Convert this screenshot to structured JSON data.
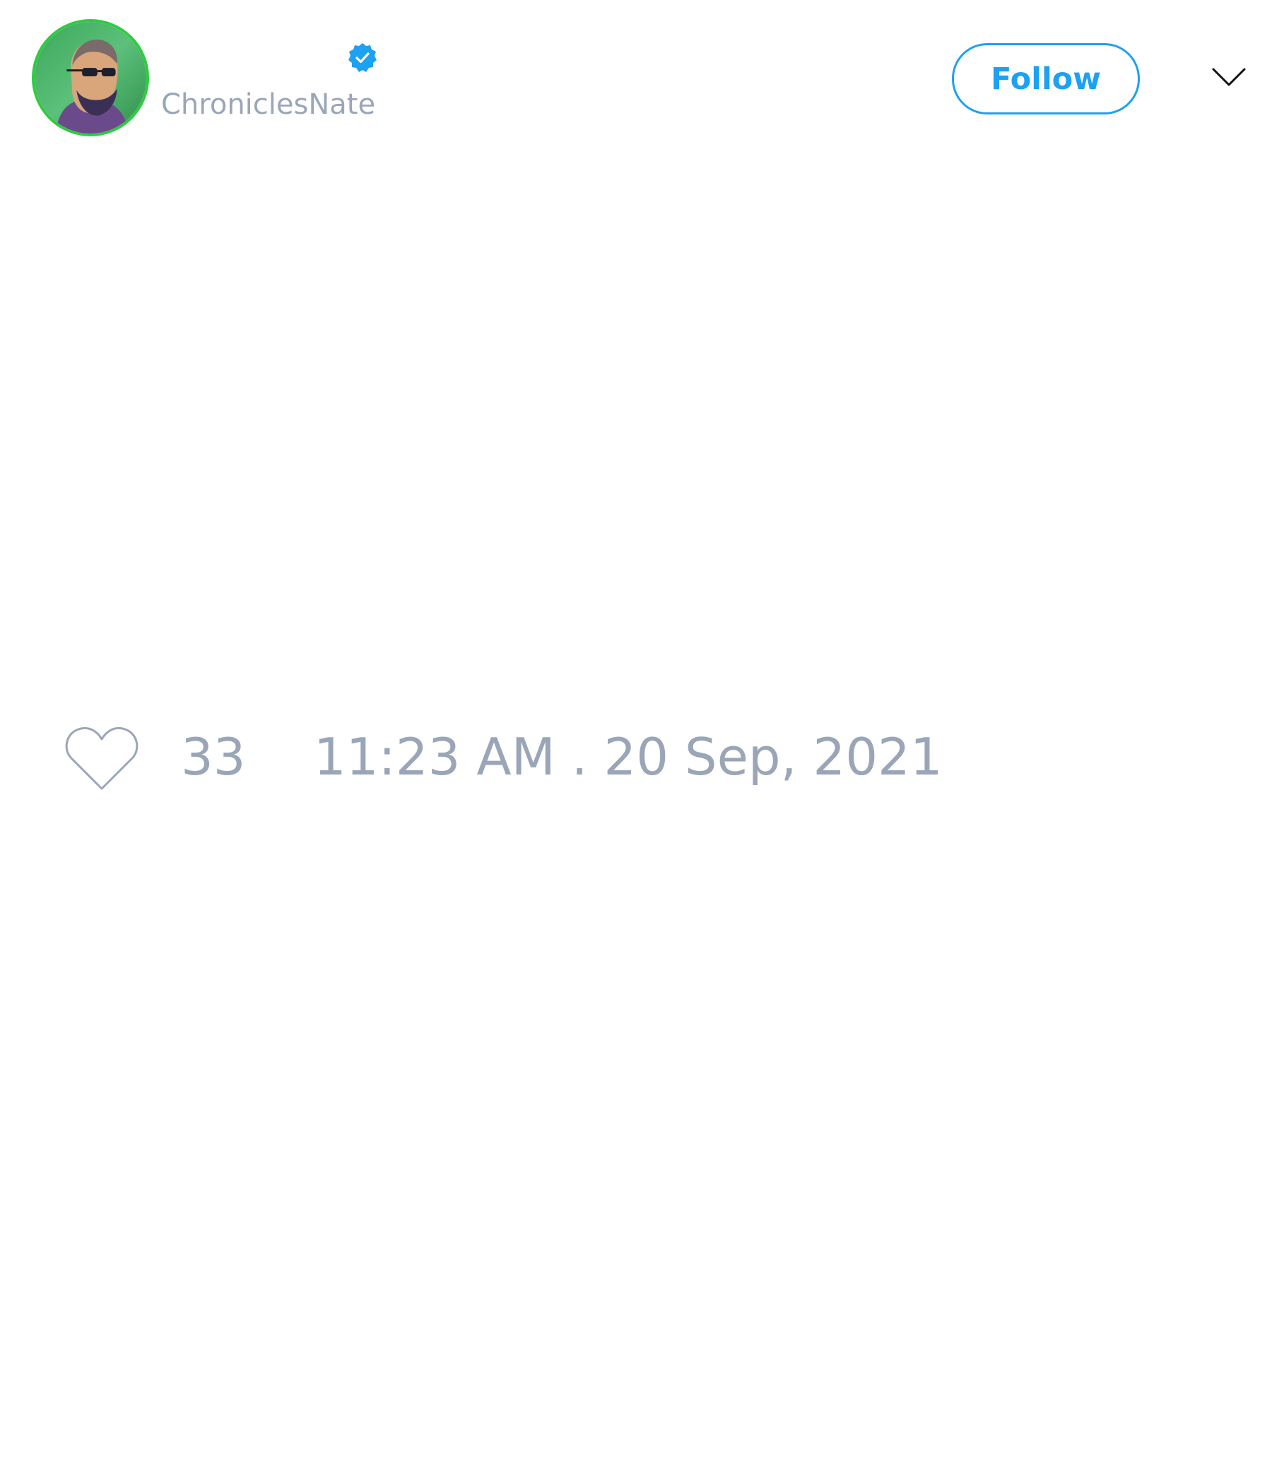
{
  "header": {
    "handle": "ChroniclesNate",
    "verified_icon": "verified-badge-icon",
    "follow_label": "Follow",
    "more_icon": "chevron-down-icon"
  },
  "tweet": {
    "like_icon": "heart-outline-icon",
    "like_count": "33",
    "timestamp": "11:23 AM . 20 Sep, 2021"
  },
  "colors": {
    "accent": "#1da1f2",
    "muted_text": "#9aa6b8",
    "avatar_ring": "#2ecc40",
    "background": "#ffffff"
  }
}
